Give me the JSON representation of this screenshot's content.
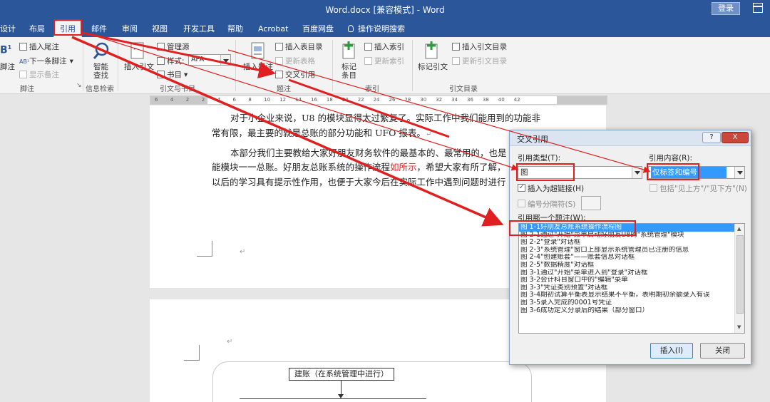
{
  "window": {
    "title": "Word.docx [兼容模式] - Word",
    "login": "登录"
  },
  "tabs": [
    "设计",
    "布局",
    "引用",
    "邮件",
    "审阅",
    "视图",
    "开发工具",
    "帮助",
    "Acrobat",
    "百度网盘",
    "操作说明搜索"
  ],
  "active_tab": "引用",
  "ribbon": {
    "footnote": {
      "insert_footnote_big": "脚注",
      "insert_endnote": "插入尾注",
      "next_footnote": "下一条脚注",
      "show_notes": "显示备注",
      "group": "脚注"
    },
    "research": {
      "smart_lookup_1": "智能",
      "smart_lookup_2": "查找",
      "group": "信息检索"
    },
    "citations": {
      "insert_citation": "插入引文",
      "manage_sources": "管理源",
      "style_label": "样式:",
      "style_value": "APA",
      "bibliography": "书目",
      "group": "引文与书目"
    },
    "captions": {
      "insert_caption": "插入题注",
      "insert_table_of_figures": "插入表目录",
      "update_table": "更新表格",
      "cross_reference": "交叉引用",
      "group": "题注"
    },
    "index": {
      "mark_entry_1": "标记",
      "mark_entry_2": "条目",
      "insert_index": "插入索引",
      "update_index": "更新索引",
      "group": "索引"
    },
    "toa": {
      "mark_citation": "标记引文",
      "insert_toa": "插入引文目录",
      "update_toa": "更新引文目录",
      "group": "引文目录"
    }
  },
  "ruler": [
    "6",
    "4",
    "2",
    "2",
    "4",
    "6",
    "8",
    "10",
    "12",
    "14",
    "16",
    "18",
    "20",
    "22",
    "24",
    "26",
    "28",
    "30",
    "32",
    "34",
    "36",
    "38",
    "40",
    "42"
  ],
  "document": {
    "para1_line1": "对于小企业来说，U8 的模块显得太过繁复了。实际工作中我们能用到的功能非",
    "para1_line2": "常有限，最主要的就是总账的部分功能和 UFO 报表。",
    "para2_line1": "本部分我们主要教给大家好朋友财务软件的最基本的、最常用的，也是",
    "para2_line2a": "能模块一一总账。好朋友总账系统的操作流程",
    "para2_line2_red": "如所示",
    "para2_line2b": "，希望大家有所了解，",
    "para2_line3": "以后的学习具有提示性作用，也便于大家今后在实际工作中遇到问题时进行",
    "return_mark": "↵",
    "flow_box": "建账（在系统管理中进行）"
  },
  "dialog": {
    "title": "交叉引用",
    "help": "?",
    "close": "X",
    "ref_type_label": "引用类型(T):",
    "ref_type_value": "图",
    "ref_content_label": "引用内容(R):",
    "ref_content_value": "仅标签和编号",
    "insert_hyperlink": "插入为超链接(H)",
    "include_above_below": "包括\"见上方\"/\"见下方\"(N)",
    "separate_numbers": "编号分隔符(S)",
    "which_caption_label": "引用哪一个题注(W):",
    "captions": [
      "图 1-1好朋友总账系统操作流程图",
      "图 2-1通过\"开始\"菜单启动好朋友U8的\"系统管理\"模块",
      "图 2-2\"登录\"对话框",
      "图 2-3\"系统管理\"窗口上部显示系统管理员已注册的信息",
      "图 2-4\"创建账套\"——账套信息对话框",
      "图 2-5\"数据精度\"对话框",
      "图 3-1通过\"开始\"菜单进入到\"登录\"对话框",
      "图 3-2会计科目窗口中的\"编辑\"菜单",
      "图 3-3\"凭证类别预置\"对话框",
      "图 3-4期初试算平衡表显示结果不平衡，表明期初余额录入有误",
      "图 3-5录入完成的0001号凭证",
      "图 3-6成功定义分录后的结果（部分窗口）"
    ],
    "selected_index": 0,
    "insert_button": "插入(I)",
    "close_button": "关闭"
  },
  "colors": {
    "title_bar": "#2b579a",
    "annotation": "#e02020",
    "selection": "#3399ff"
  }
}
